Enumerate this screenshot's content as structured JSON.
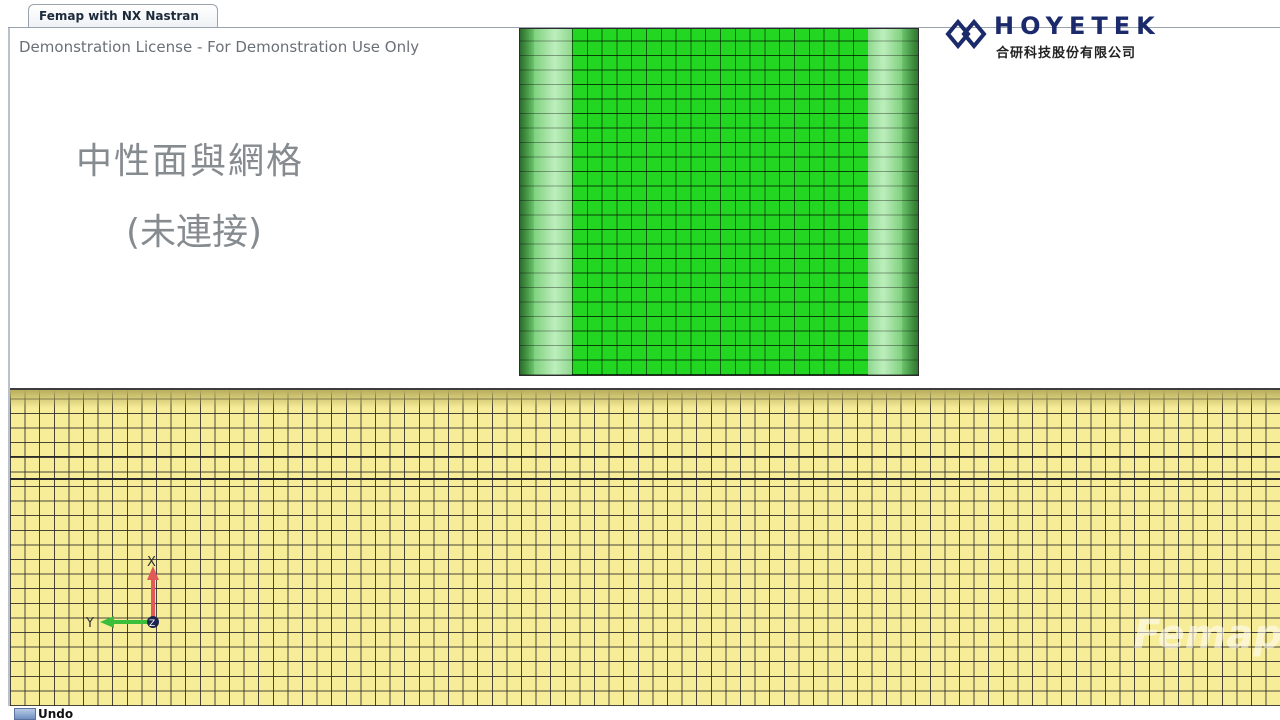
{
  "window": {
    "tab_title": "Femap with NX Nastran"
  },
  "viewport": {
    "license_notice": "Demonstration License - For Demonstration Use Only",
    "caption_line1": "中性面與網格",
    "caption_line2": "(未連接)",
    "watermark": "Femap",
    "triad": {
      "x_label": "X",
      "y_label": "Y",
      "z_label": "Z"
    }
  },
  "logo": {
    "name": "HOYETEK",
    "subtitle": "合研科技股份有限公司"
  },
  "status": {
    "label": "Undo"
  },
  "colors": {
    "green_mesh": "#22d622",
    "yellow_mesh": "#f7ec97",
    "x_axis": "#e05a5a",
    "y_axis": "#3bbf3b",
    "logo_blue": "#1b2a6b"
  }
}
